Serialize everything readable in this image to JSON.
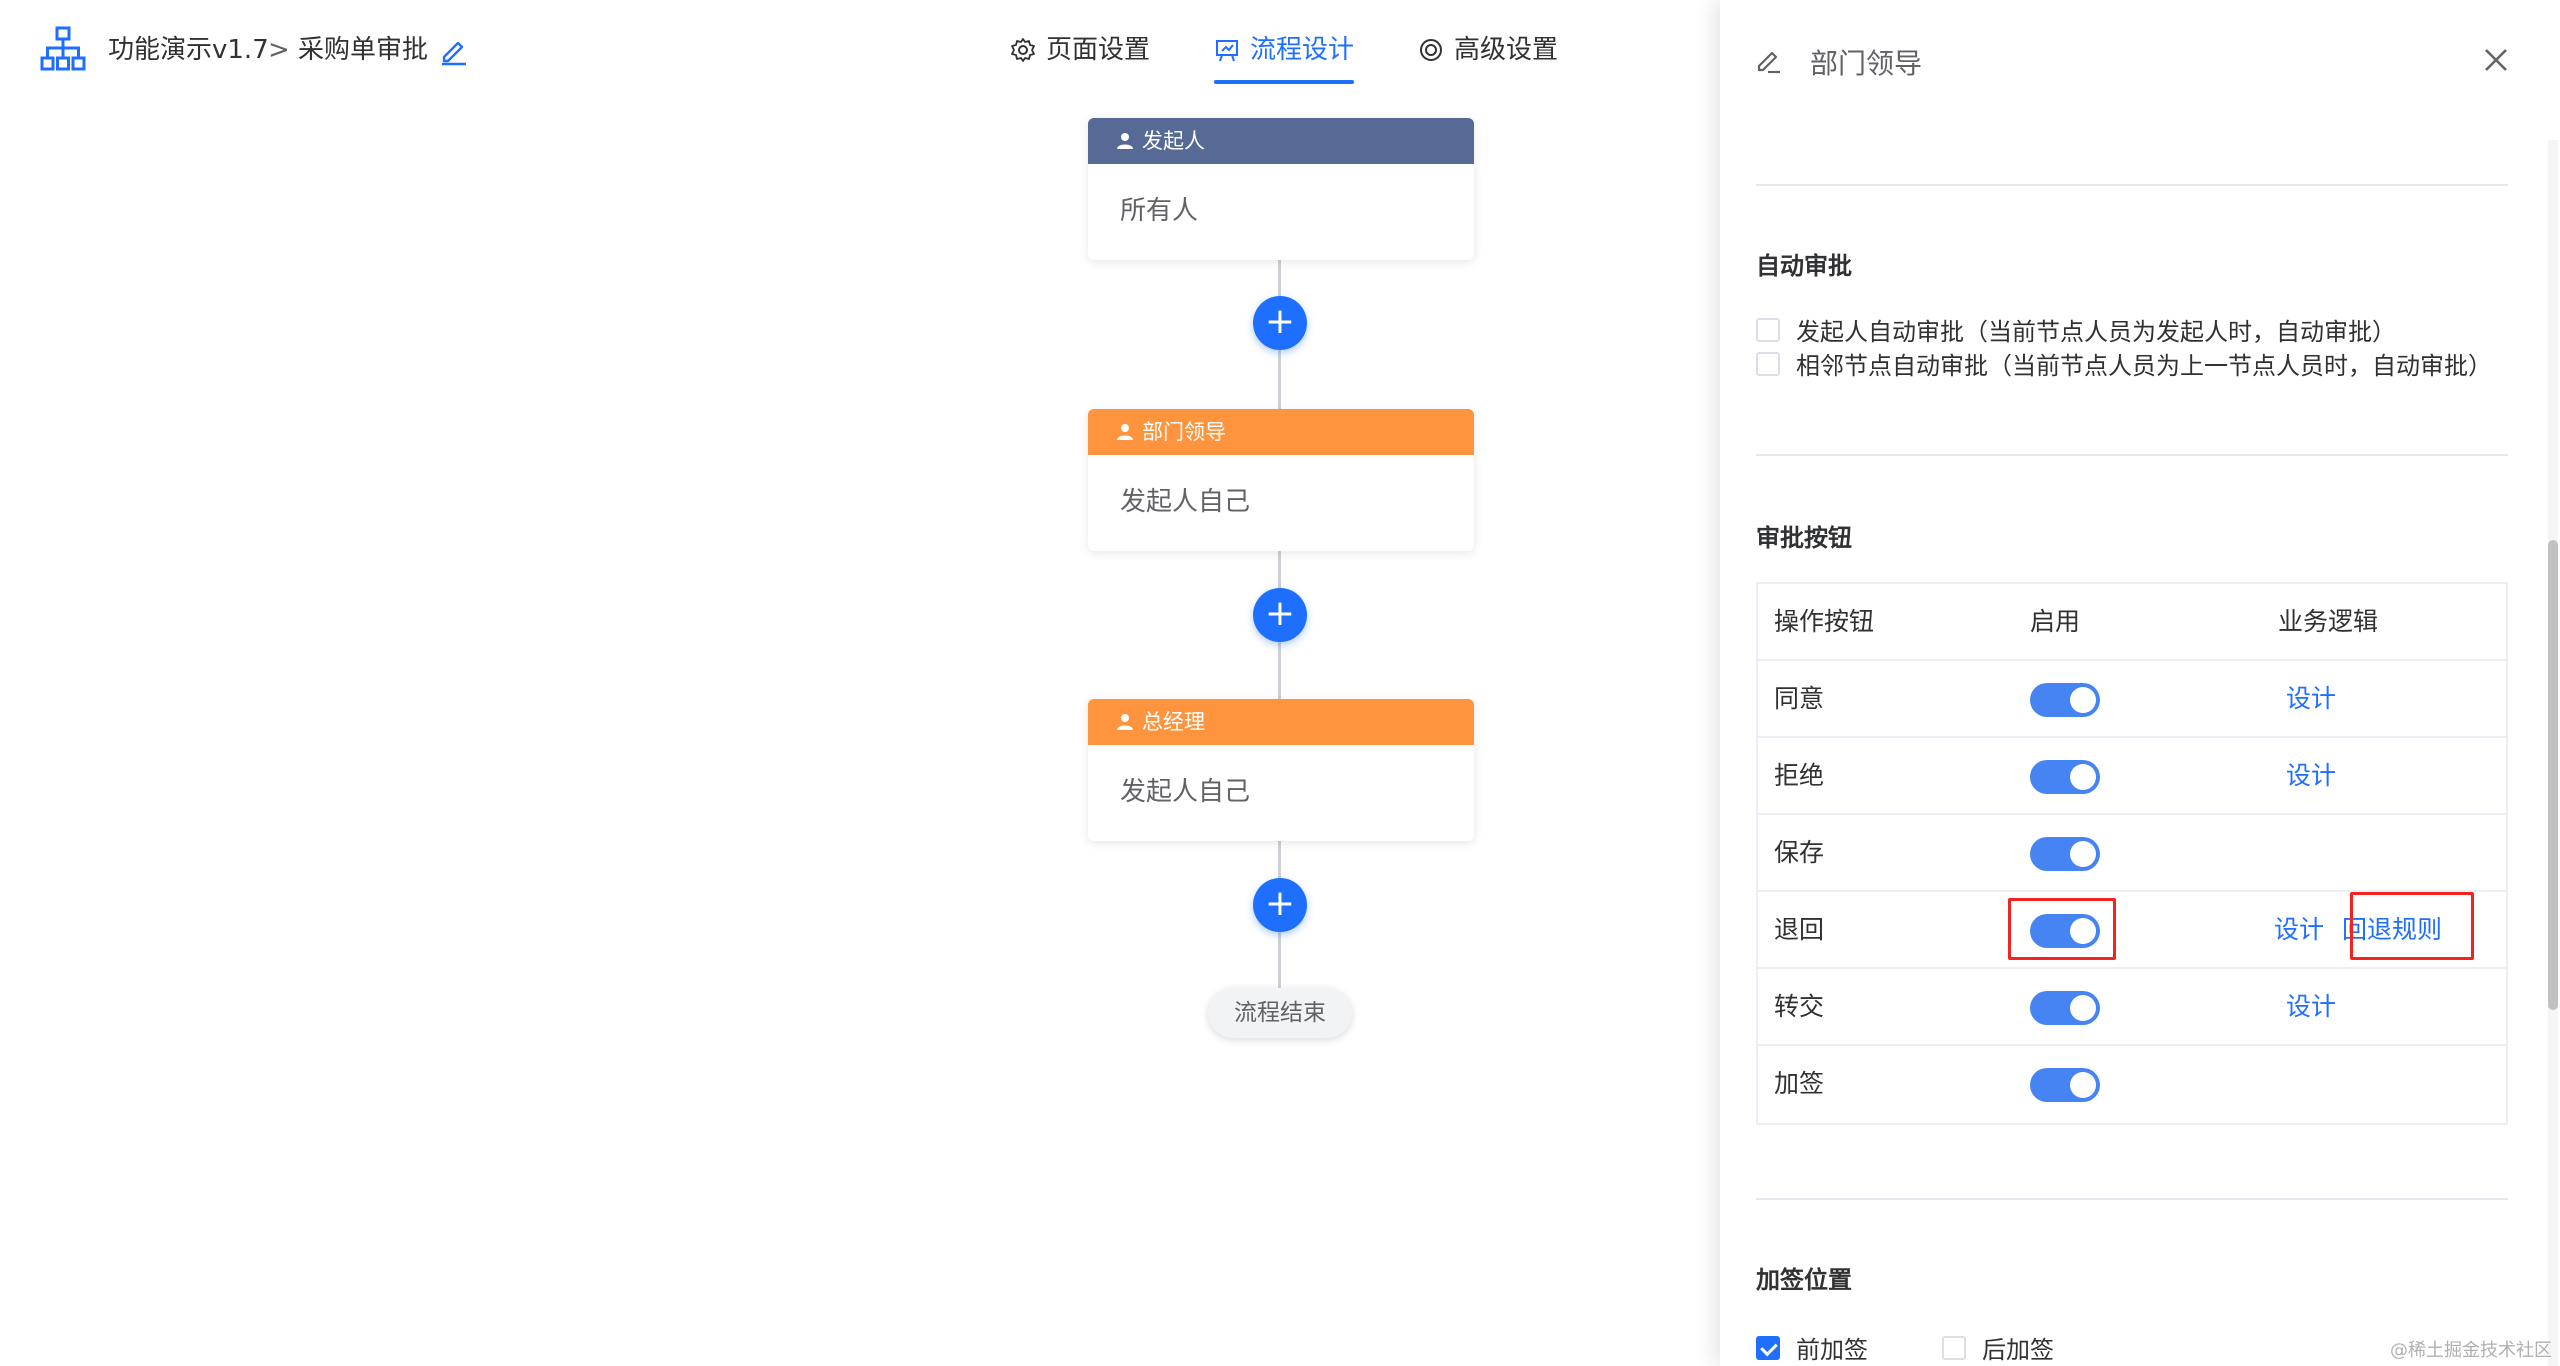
{
  "header": {
    "app_name": "功能演示v1.7",
    "separator": ">",
    "form_name": "采购单审批",
    "tabs": [
      {
        "label": "页面设置",
        "icon": "gear-icon"
      },
      {
        "label": "流程设计",
        "icon": "flow-icon",
        "active": true
      },
      {
        "label": "高级设置",
        "icon": "settings-icon"
      }
    ]
  },
  "flow": {
    "nodes": [
      {
        "title": "发起人",
        "body": "所有人",
        "color": "#576a95"
      },
      {
        "title": "部门领导",
        "body": "发起人自己",
        "color": "#ff943e"
      },
      {
        "title": "总经理",
        "body": "发起人自己",
        "color": "#ff943e"
      }
    ],
    "add_symbol": "+",
    "end_label": "流程结束"
  },
  "drawer": {
    "title": "部门领导",
    "auto_approve": {
      "title": "自动审批",
      "options": [
        {
          "label": "发起人自动审批（当前节点人员为发起人时，自动审批）",
          "checked": false
        },
        {
          "label": "相邻节点自动审批（当前节点人员为上一节点人员时，自动审批）",
          "checked": false
        }
      ]
    },
    "buttons_section": {
      "title": "审批按钮",
      "columns": [
        "操作按钮",
        "启用",
        "业务逻辑"
      ],
      "rows": [
        {
          "name": "同意",
          "enabled": true,
          "design": "设计",
          "extra": ""
        },
        {
          "name": "拒绝",
          "enabled": true,
          "design": "设计",
          "extra": ""
        },
        {
          "name": "保存",
          "enabled": true,
          "design": "",
          "extra": ""
        },
        {
          "name": "退回",
          "enabled": true,
          "design": "设计",
          "extra": "回退规则"
        },
        {
          "name": "转交",
          "enabled": true,
          "design": "设计",
          "extra": ""
        },
        {
          "name": "加签",
          "enabled": true,
          "design": "",
          "extra": ""
        }
      ]
    },
    "sign_position": {
      "title": "加签位置",
      "options": [
        {
          "label": "前加签",
          "checked": true
        },
        {
          "label": "后加签",
          "checked": false
        }
      ]
    }
  },
  "watermark": "@稀土掘金技术社区",
  "colors": {
    "primary": "#1f6fff",
    "switch": "#4584f2",
    "highlight": "#f52222"
  }
}
